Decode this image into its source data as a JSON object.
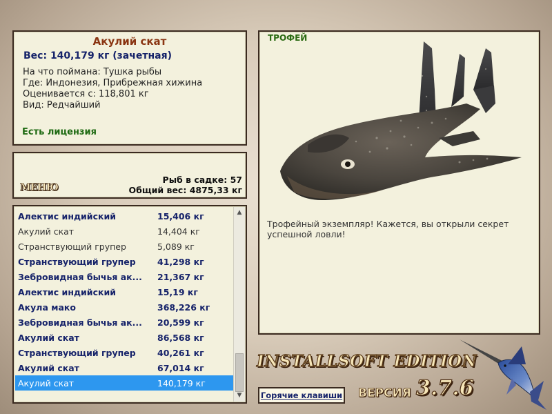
{
  "info": {
    "title": "Акулий скат",
    "weight": "Вес: 140,179 кг (зачетная)",
    "bait": "На что поймана: Тушка рыбы",
    "location": "Где: Индонезия, Прибрежная хижина",
    "value": "Оценивается с: 118,801 кг",
    "rarity": "Вид: Редчайший",
    "license": "Есть лицензия"
  },
  "menu": {
    "label": "МЕНЮ",
    "fish_count": "Рыб в садке: 57",
    "total_weight": "Общий вес: 4875,33 кг"
  },
  "list": {
    "items": [
      {
        "name": "Алектис индийский",
        "weight": "15,406 кг"
      },
      {
        "name": "Акулий скат",
        "weight": "14,404 кг"
      },
      {
        "name": "Странствующий групер",
        "weight": "5,089 кг"
      },
      {
        "name": "Странствующий групер",
        "weight": "41,298 кг"
      },
      {
        "name": "Зебровидная бычья ак...",
        "weight": "21,367 кг"
      },
      {
        "name": "Алектис индийский",
        "weight": "15,19 кг"
      },
      {
        "name": "Акула мако",
        "weight": "368,226 кг"
      },
      {
        "name": "Зебровидная бычья ак...",
        "weight": "20,599 кг"
      },
      {
        "name": "Акулий скат",
        "weight": "86,568 кг"
      },
      {
        "name": "Странствующий групер",
        "weight": "40,261 кг"
      },
      {
        "name": "Акулий скат",
        "weight": "67,014 кг"
      },
      {
        "name": "Акулий скат",
        "weight": "140,179 кг"
      }
    ]
  },
  "trophy": {
    "label": "ТРОФЕЙ",
    "description": "Трофейный экземпляр! Кажется, вы открыли секрет успешной ловли!"
  },
  "footer": {
    "brand": "INSTALLSOFT EDITION",
    "hotkeys": "Горячие клавиши",
    "version_label": "ВЕРСИЯ",
    "version_number": "3.7.6"
  },
  "icons": {
    "scroll_up": "chevron-up-icon",
    "scroll_down": "chevron-down-icon",
    "fish": "shark-ray-image",
    "logo": "marlin-logo"
  },
  "colors": {
    "panel_bg": "#f3f1dd",
    "title": "#8a3512",
    "bold_text": "#16236a",
    "license": "#1e6a12",
    "selection": "#2d97ef"
  }
}
